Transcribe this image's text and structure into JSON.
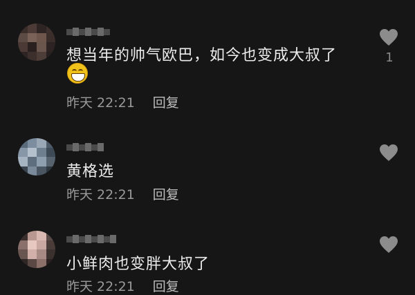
{
  "comments": [
    {
      "text": "想当年的帅气欧巴，如今也变成大叔了",
      "time": "昨天 22:21",
      "reply": "回复",
      "likes": "1",
      "emoji": "grinning-face"
    },
    {
      "text": "黄格选",
      "time": "昨天 22:21",
      "reply": "回复"
    },
    {
      "text": "小鲜肉也变胖大叔了",
      "time": "昨天 22:21",
      "reply": "回复"
    }
  ],
  "icons": {
    "like": "heart-icon"
  },
  "colors": {
    "background": "#161616",
    "text": "#ececec",
    "meta": "#9a9a9a",
    "heart": "#8c8c8c"
  }
}
